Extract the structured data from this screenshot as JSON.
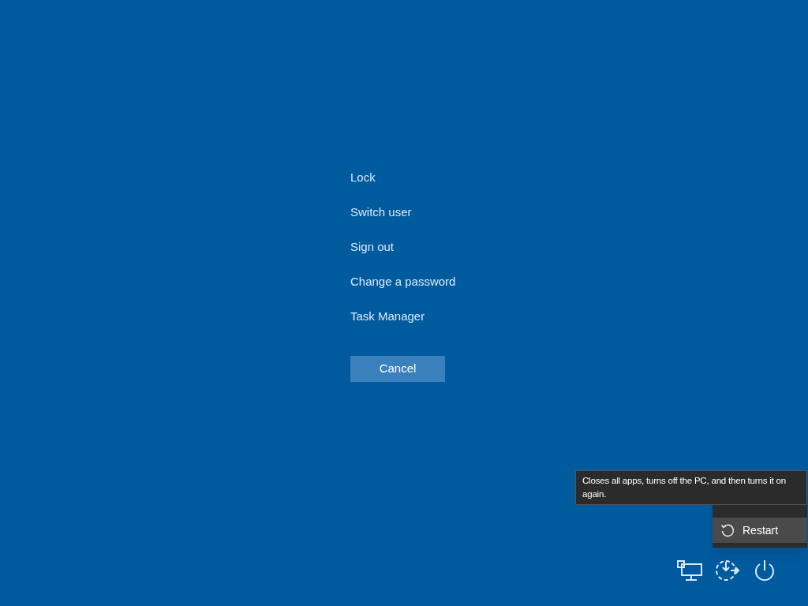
{
  "options": [
    {
      "label": "Lock"
    },
    {
      "label": "Switch user"
    },
    {
      "label": "Sign out"
    },
    {
      "label": "Change a password"
    },
    {
      "label": "Task Manager"
    }
  ],
  "cancel_button": "Cancel",
  "power_menu": {
    "items": [
      {
        "label": "Restart",
        "kind": "restart",
        "selected": true
      }
    ]
  },
  "tooltip": "Closes all apps, turns off the PC, and then turns it on again.",
  "tray": [
    {
      "kind": "network"
    },
    {
      "kind": "accessibility"
    },
    {
      "kind": "power"
    }
  ]
}
